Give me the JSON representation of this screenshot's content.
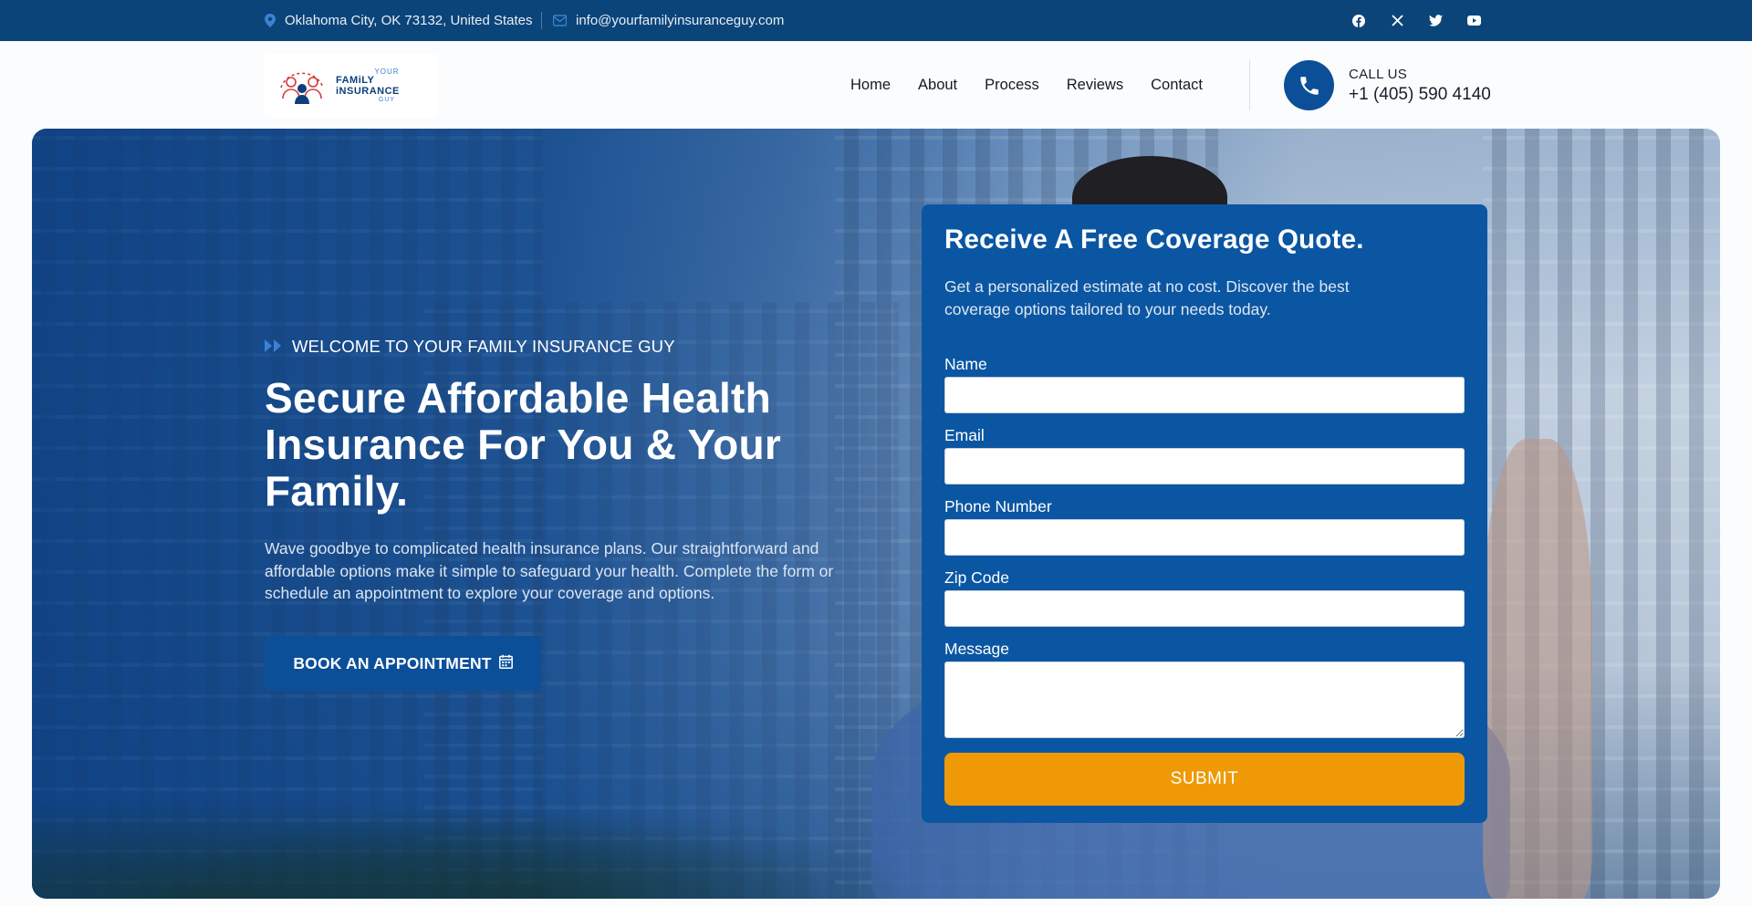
{
  "topbar": {
    "location": "Oklahoma City, OK 73132, United States",
    "email": "info@yourfamilyinsuranceguy.com",
    "socials": [
      "facebook-icon",
      "x-icon",
      "twitter-icon",
      "youtube-icon"
    ]
  },
  "logo": {
    "line1": "YOUR",
    "line2": "FAMiLY iNSURANCE",
    "line3": "GUY"
  },
  "nav": {
    "items": [
      "Home",
      "About",
      "Process",
      "Reviews",
      "Contact"
    ]
  },
  "call": {
    "label": "CALL US",
    "number": "+1 (405) 590 4140"
  },
  "hero": {
    "eyebrow": "WELCOME TO YOUR FAMILY INSURANCE GUY",
    "headline": "Secure Affordable Health Insurance For You & Your Family.",
    "lead": "Wave goodbye to complicated health insurance plans. Our straightforward and affordable options make it simple to safeguard your health. Complete the form or schedule an appointment to explore your coverage and options.",
    "cta": "BOOK AN APPOINTMENT"
  },
  "form": {
    "title": "Receive A Free Coverage Quote.",
    "description": "Get a personalized estimate at no cost. Discover the best coverage options tailored to your needs today.",
    "fields": {
      "name": "Name",
      "email": "Email",
      "phone": "Phone Number",
      "zip": "Zip Code",
      "message": "Message"
    },
    "submit": "SUBMIT"
  },
  "colors": {
    "topbar": "#0b4479",
    "primary": "#0b56a3",
    "button": "#0b4f99",
    "submit": "#ee9905"
  }
}
